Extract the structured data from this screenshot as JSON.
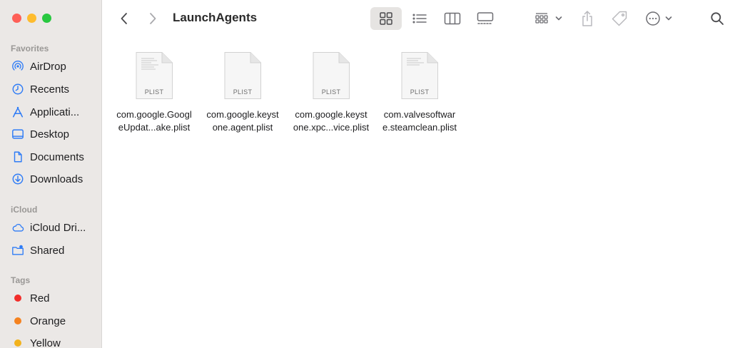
{
  "window": {
    "title": "LaunchAgents"
  },
  "sidebar": {
    "sections": {
      "favorites": "Favorites",
      "icloud": "iCloud",
      "tags": "Tags"
    },
    "favorites": [
      {
        "label": "AirDrop",
        "icon": "airdrop-icon"
      },
      {
        "label": "Recents",
        "icon": "clock-icon"
      },
      {
        "label": "Applicati...",
        "icon": "applications-icon"
      },
      {
        "label": "Desktop",
        "icon": "desktop-icon"
      },
      {
        "label": "Documents",
        "icon": "document-icon"
      },
      {
        "label": "Downloads",
        "icon": "download-icon"
      }
    ],
    "icloud": [
      {
        "label": "iCloud Dri...",
        "icon": "cloud-icon"
      },
      {
        "label": "Shared",
        "icon": "shared-folder-icon"
      }
    ],
    "tags": [
      {
        "label": "Red",
        "color": "#f22d2a"
      },
      {
        "label": "Orange",
        "color": "#f5821f"
      },
      {
        "label": "Yellow",
        "color": "#f2b21c"
      }
    ]
  },
  "files": [
    {
      "line1": "com.google.Googl",
      "line2": "eUpdat...ake.plist",
      "type": "PLIST"
    },
    {
      "line1": "com.google.keyst",
      "line2": "one.agent.plist",
      "type": "PLIST"
    },
    {
      "line1": "com.google.keyst",
      "line2": "one.xpc...vice.plist",
      "type": "PLIST"
    },
    {
      "line1": "com.valvesoftwar",
      "line2": "e.steamclean.plist",
      "type": "PLIST"
    }
  ],
  "colors": {
    "accent": "#2f7cf6",
    "sidebar_bg": "#ebe8e6"
  }
}
